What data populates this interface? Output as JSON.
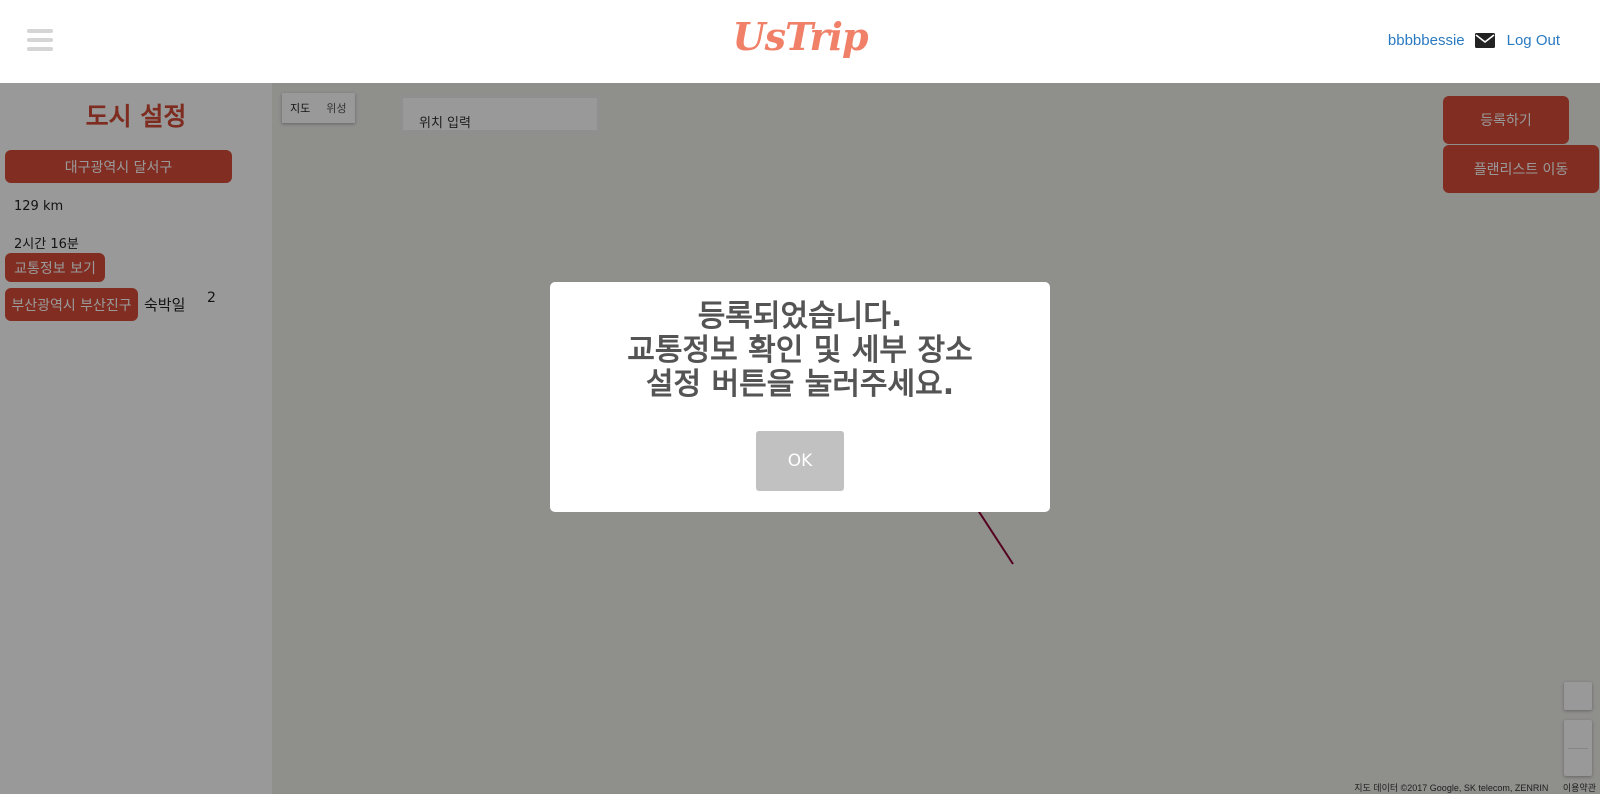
{
  "header": {
    "logo": "UsTrip",
    "username": "bbbbbessie",
    "logout_label": "Log Out"
  },
  "sidebar": {
    "title": "도시 설정",
    "city_button": "대구광역시 달서구",
    "distance": "129 km",
    "duration": "2시간 16분",
    "traffic_button": "교통정보 보기",
    "destination_button": "부산광역시 부산진구",
    "stay_label": "숙박일",
    "stay_value": "2"
  },
  "map": {
    "type_map": "지도",
    "type_satellite": "위성",
    "location_placeholder": "위치 입력",
    "register_button": "등록하기",
    "planlist_button": "플랜리스트 이동",
    "footer_attribution": "지도 데이터 ©2017 Google, SK telecom, ZENRIN",
    "footer_terms": "이용약관"
  },
  "modal": {
    "line1": "등록되었습니다.",
    "line2": "교통정보 확인 및 세부 장소",
    "line3": "설정 버튼을 눌러주세요.",
    "ok_label": "OK"
  },
  "colors": {
    "brand": "#f08068",
    "accent_button": "#d84c3a",
    "link": "#2a7ac0",
    "route_line": "#8b0033"
  },
  "icons": {
    "menu": "hamburger-icon",
    "mail": "envelope-icon"
  }
}
